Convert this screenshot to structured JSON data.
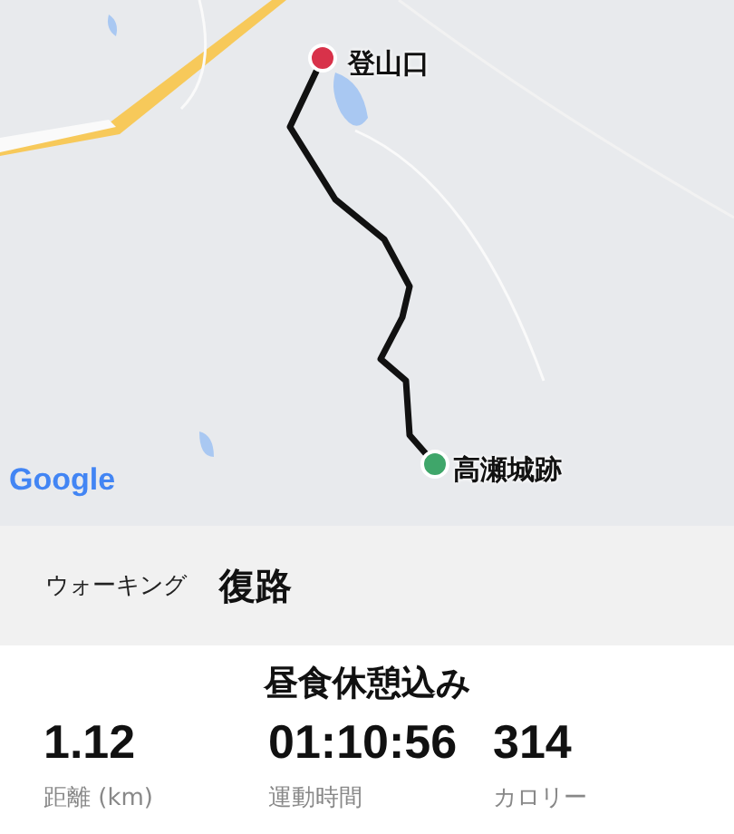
{
  "map": {
    "kind": "picture",
    "attribution": "Google",
    "markers": [
      {
        "label": "登山口",
        "color": "#d8324a"
      },
      {
        "label": "高瀬城跡",
        "color": "#3fa66a"
      }
    ]
  },
  "activity": {
    "type": "ウォーキング",
    "title": "復路"
  },
  "note": "昼食休憩込み",
  "stats": [
    {
      "value": "1.12",
      "label": "距離 (km)"
    },
    {
      "value": "01:10:56",
      "label": "運動時間"
    },
    {
      "value": "314",
      "label": "カロリー"
    }
  ]
}
